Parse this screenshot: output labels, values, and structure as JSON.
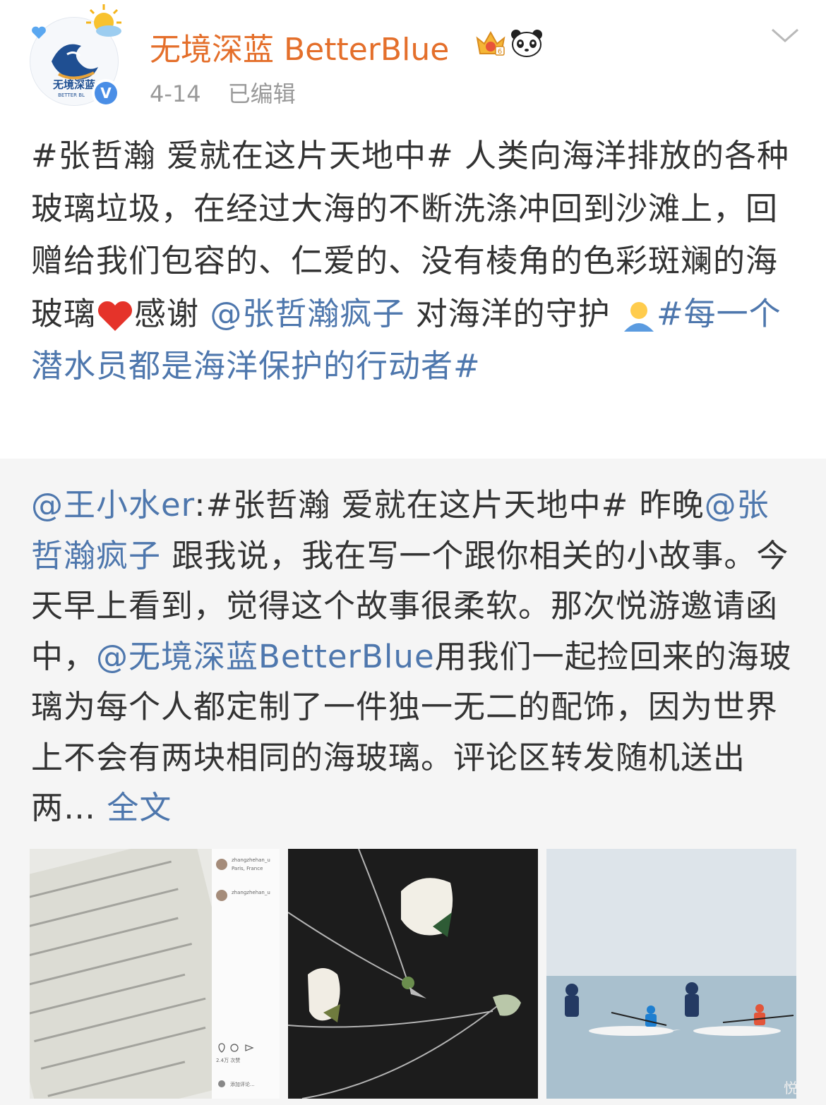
{
  "header": {
    "username": "无境深蓝 BetterBlue",
    "date": "4-14",
    "edited": "已编辑",
    "avatar_text": "无境深蓝",
    "avatar_subtext": "BETTER BL",
    "verified_mark": "V"
  },
  "post": {
    "topic": "#张哲瀚 爱就在这片天地中#",
    "text_1": " 人类向海洋排放的各种玻璃垃圾，在经过大海的不断洗涤冲回到沙滩上，回赠给我们包容的、仁爱的、没有棱角的色彩斑斓的海玻璃",
    "text_2": "感谢 ",
    "mention": "@张哲瀚疯子",
    "text_3": " 对海洋的守护 ",
    "topic_2": "#每一个潜水员都是海洋保护的行动者#"
  },
  "repost": {
    "author": "@王小水er",
    "text_1": ":#张哲瀚 爱就在这片天地中# 昨晚",
    "mention_1": "@张哲瀚疯子",
    "text_2": " 跟我说，我在写一个跟你相关的小故事。今天早上看到，觉得这个故事很柔软。那次悦游邀请函中，",
    "mention_2": "@无境深蓝BetterBlue",
    "text_3": "用我们一起捡回来的海玻璃为每个人都定制了一件独一无二的配饰，因为世界上不会有两块相同的海玻璃。评论区转发随机送出两…",
    "full_text": " 全文"
  },
  "images": {
    "img1_panel": {
      "user": "zhangzhehan_u",
      "location": "Paris, France",
      "user2": "zhangzhehan_u",
      "likes": "2.4万 次赞",
      "comment_placeholder": "添加评论..."
    },
    "img3_watermark": "悦"
  },
  "colors": {
    "username": "#e46f2b",
    "link": "#4e77ad",
    "meta": "#999999",
    "repost_bg": "#f5f5f5",
    "verified": "#4a8ee6"
  },
  "icons": [
    "heart-icon",
    "sun-icon",
    "verified-icon",
    "vip-crown-icon",
    "panda-icon",
    "chevron-down-icon",
    "red-heart-emoji",
    "person-emoji"
  ]
}
